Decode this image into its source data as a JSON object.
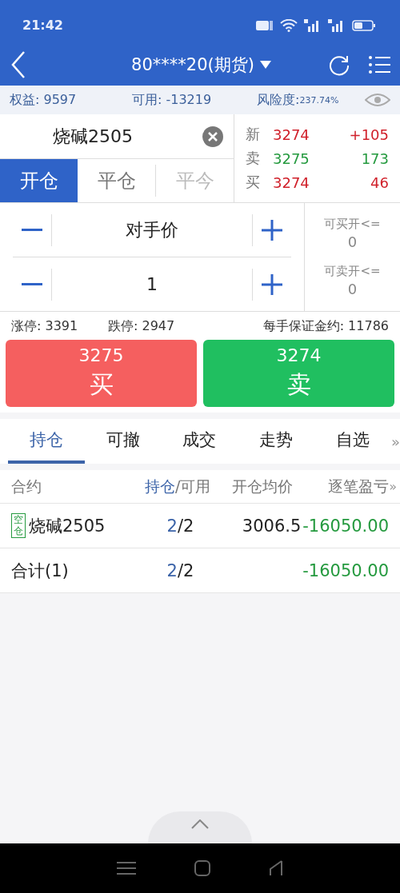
{
  "status_bar": {
    "time": "21:42"
  },
  "header": {
    "title": "80****20(期货)"
  },
  "account": {
    "equity": "权益: 9597",
    "available": "可用: -13219",
    "risk_label": "风险度:",
    "risk_value": "237.74%"
  },
  "search": {
    "value": "烧碱2505"
  },
  "mode_tabs": [
    {
      "label": "开仓",
      "selected": true,
      "disabled": false
    },
    {
      "label": "平仓",
      "selected": false,
      "disabled": false
    },
    {
      "label": "平今",
      "selected": false,
      "disabled": true
    }
  ],
  "quotes": [
    {
      "label": "新",
      "price": "3274",
      "change": "+105",
      "color": "#d0202a"
    },
    {
      "label": "卖",
      "price": "3275",
      "change": "173",
      "color": "#259a3f"
    },
    {
      "label": "买",
      "price": "3274",
      "change": "46",
      "color": "#d0202a"
    }
  ],
  "steppers": [
    {
      "value": "对手价"
    },
    {
      "value": "1"
    }
  ],
  "limits": [
    {
      "label": "可买开<=",
      "value": "0"
    },
    {
      "label": "可卖开<=",
      "value": "0"
    }
  ],
  "price_info": {
    "up_limit": "涨停: 3391",
    "down_limit": "跌停: 2947",
    "margin": "每手保证金约: 11786"
  },
  "actions": [
    {
      "kind": "buy",
      "price": "3275",
      "label": "买"
    },
    {
      "kind": "sell",
      "price": "3274",
      "label": "卖"
    }
  ],
  "bottom_tabs": [
    {
      "label": "持仓",
      "selected": true
    },
    {
      "label": "可撤",
      "selected": false
    },
    {
      "label": "成交",
      "selected": false
    },
    {
      "label": "走势",
      "selected": false
    },
    {
      "label": "自选",
      "selected": false
    }
  ],
  "more_tabs": "»",
  "table": {
    "columns": [
      {
        "parts": [
          {
            "text": "合约",
            "accent": false
          }
        ]
      },
      {
        "parts": [
          {
            "text": "持仓",
            "accent": true
          },
          {
            "text": "/可用",
            "accent": false
          }
        ]
      },
      {
        "parts": [
          {
            "text": "开仓均价",
            "accent": false
          }
        ]
      },
      {
        "parts": [
          {
            "text": "逐笔盈亏",
            "accent": false
          }
        ]
      }
    ],
    "more_columns": "»",
    "rows": [
      {
        "tag": "空仓",
        "contract": "烧碱2505",
        "held": "2",
        "available": "/2",
        "avg_price": "3006.5",
        "pnl": "-16050.00"
      },
      {
        "contract": "合计(1)",
        "held": "2",
        "available": "/2",
        "pnl": "-16050.00"
      }
    ]
  }
}
